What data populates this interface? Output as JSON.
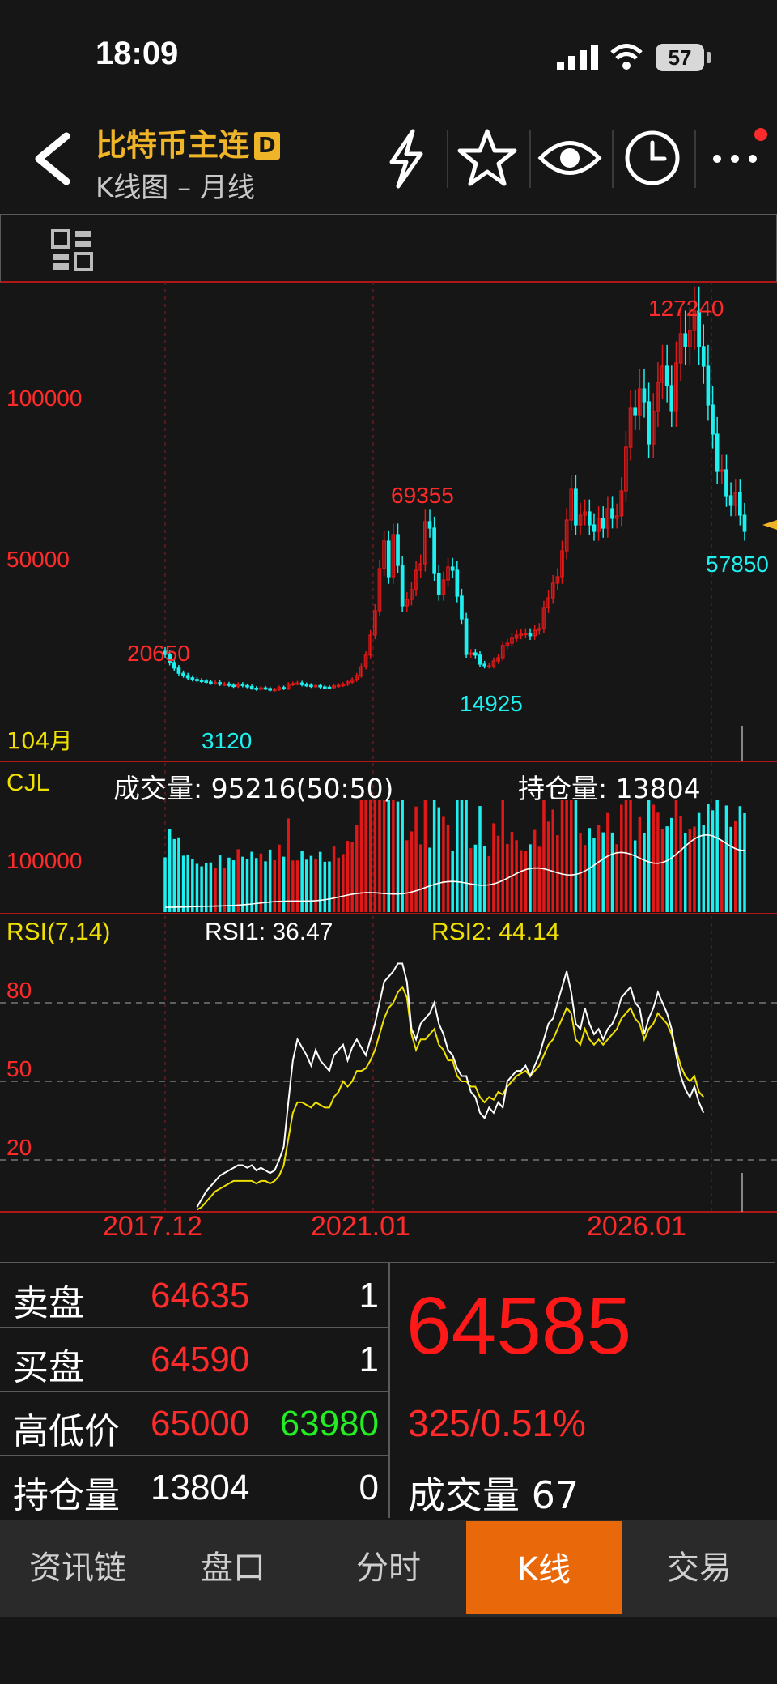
{
  "status_bar": {
    "time": "18:09",
    "battery": "57"
  },
  "header": {
    "title": "比特币主连",
    "badge": "D",
    "subtitle": "K线图 – 月线",
    "icons": [
      "back-icon",
      "lightning-icon",
      "star-icon",
      "eye-icon",
      "clock-icon",
      "more-icon"
    ]
  },
  "toolbar": {
    "icons": [
      "grid-layout-icon"
    ]
  },
  "chart": {
    "price_axis": [
      "100000",
      "50000"
    ],
    "current_period": "104月",
    "annotations": {
      "high_2017": "20650",
      "low": "3120",
      "high_2021": "69355",
      "low_2022": "14925",
      "high_all": "127240",
      "last": "57850"
    },
    "volume_panel": {
      "label": "CJL",
      "volume_text": "成交量: 95216(50:50)",
      "oi_text": "持仓量: 13804",
      "axis": "100000"
    },
    "rsi_panel": {
      "label": "RSI(7,14)",
      "rsi1": "RSI1: 36.47",
      "rsi2": "RSI2: 44.14",
      "levels": [
        "80",
        "50",
        "20"
      ]
    },
    "x_labels": [
      "2017.12",
      "2021.01",
      "2026.01"
    ]
  },
  "chart_data": {
    "type": "candlestick",
    "title": "",
    "ylabel": "",
    "ylim": [
      0,
      135000
    ],
    "closes": [
      20000,
      17500,
      15800,
      14200,
      13500,
      12800,
      12300,
      12000,
      11800,
      11500,
      11200,
      11300,
      10800,
      10900,
      10500,
      10200,
      10800,
      10400,
      10100,
      9600,
      9300,
      9700,
      9500,
      9000,
      9200,
      9800,
      9500,
      10800,
      11000,
      11200,
      10700,
      10500,
      10200,
      10400,
      10000,
      9900,
      9800,
      10300,
      10500,
      10800,
      11500,
      12200,
      13500,
      16200,
      19800,
      26000,
      33500,
      46500,
      55000,
      44000,
      57000,
      47500,
      35000,
      37000,
      40000,
      46000,
      48000,
      61000,
      59000,
      45000,
      38500,
      43000,
      47000,
      46000,
      38000,
      31000,
      20000,
      20500,
      19800,
      17000,
      16500,
      16500,
      18000,
      19000,
      22800,
      23500,
      25000,
      26000,
      26300,
      26500,
      25800,
      27500,
      28000,
      34500,
      37500,
      42000,
      44000,
      52000,
      61500,
      71000,
      60000,
      63000,
      64000,
      60000,
      58000,
      62000,
      59000,
      65000,
      62000,
      62800,
      70500,
      84000,
      96000,
      94000,
      102000,
      98000,
      85000,
      95000,
      104000,
      109000,
      103000,
      95000,
      110000,
      119000,
      115000,
      120000,
      126000,
      115000,
      109000,
      97000,
      88000,
      76500,
      77000,
      69000,
      66000,
      70000,
      63000,
      58000
    ],
    "rsi1": [
      null,
      null,
      null,
      null,
      null,
      null,
      null,
      2,
      5,
      8,
      10,
      12,
      14,
      15,
      16,
      17,
      18,
      18,
      17,
      18,
      16,
      17,
      16,
      15,
      16,
      20,
      25,
      42,
      58,
      66,
      63,
      60,
      56,
      62,
      58,
      56,
      54,
      60,
      62,
      64,
      58,
      63,
      66,
      63,
      60,
      66,
      72,
      80,
      88,
      90,
      92,
      95,
      95,
      88,
      70,
      66,
      72,
      74,
      76,
      80,
      72,
      68,
      62,
      60,
      55,
      52,
      52,
      46,
      44,
      38,
      36,
      40,
      38,
      42,
      40,
      50,
      52,
      54,
      54,
      56,
      52,
      56,
      60,
      66,
      72,
      74,
      80,
      86,
      92,
      84,
      72,
      70,
      78,
      72,
      68,
      70,
      66,
      70,
      72,
      76,
      82,
      84,
      86,
      80,
      78,
      68,
      74,
      78,
      84,
      80,
      76,
      70,
      60,
      52,
      47,
      44,
      48,
      42,
      38
    ],
    "rsi2": [
      null,
      null,
      null,
      null,
      null,
      null,
      null,
      1,
      2,
      4,
      6,
      8,
      9,
      10,
      11,
      12,
      12,
      12,
      12,
      12,
      11,
      12,
      12,
      11,
      12,
      14,
      18,
      28,
      38,
      42,
      42,
      41,
      40,
      42,
      41,
      40,
      40,
      44,
      46,
      50,
      48,
      50,
      54,
      54,
      55,
      58,
      62,
      68,
      74,
      78,
      80,
      84,
      86,
      82,
      68,
      62,
      66,
      66,
      68,
      70,
      64,
      62,
      58,
      58,
      52,
      50,
      50,
      48,
      48,
      44,
      42,
      44,
      43,
      46,
      45,
      48,
      50,
      52,
      53,
      54,
      52,
      54,
      56,
      60,
      64,
      66,
      70,
      74,
      78,
      76,
      66,
      64,
      70,
      66,
      64,
      66,
      64,
      66,
      68,
      70,
      74,
      76,
      78,
      74,
      72,
      66,
      70,
      72,
      76,
      74,
      72,
      68,
      62,
      56,
      52,
      50,
      52,
      46,
      44
    ]
  },
  "quote": {
    "rows": [
      {
        "label": "卖盘",
        "v1": "64635",
        "v2": "1"
      },
      {
        "label": "买盘",
        "v1": "64590",
        "v2": "1"
      },
      {
        "label": "高低价",
        "v1": "65000",
        "v2": "63980"
      },
      {
        "label": "持仓量",
        "v1": "13804",
        "v2": "0"
      }
    ],
    "last_price": "64585",
    "change": "325/0.51%",
    "volume": "成交量 67"
  },
  "tabs": [
    "资讯链",
    "盘口",
    "分时",
    "K线",
    "交易"
  ],
  "active_tab": "K线",
  "colors": {
    "up": "#e01818",
    "down": "#1ef0f0",
    "accent": "#f0b428",
    "active_tab": "#e8680a"
  }
}
